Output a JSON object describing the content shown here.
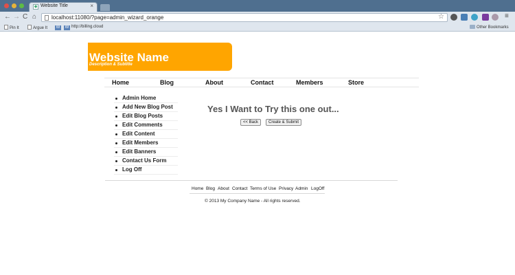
{
  "browser": {
    "tab_title": "Website Title",
    "tab_close": "×",
    "url": "localhost:11080/?page=admin_wizard_orange",
    "menu_glyph": "≡",
    "star_glyph": "☆",
    "nav": {
      "back": "←",
      "forward": "→",
      "reload": "C",
      "home": "⌂"
    },
    "bookmarks": [
      "Pin It",
      "Argue It",
      "http://billing.cloud",
      "Other Bookmarks"
    ]
  },
  "site": {
    "name": "Website Name",
    "description": "Description & Subtitle",
    "accent_color": "#ffa500"
  },
  "main_nav": [
    "Home",
    "Blog",
    "About",
    "Contact",
    "Members",
    "Store"
  ],
  "sidebar": [
    "Admin Home",
    "Add New Blog Post",
    "Edit Blog Posts",
    "Edit Comments",
    "Edit Content",
    "Edit Members",
    "Edit Banners",
    "Contact Us Form",
    "Log Off"
  ],
  "content": {
    "title": "Yes I Want to Try this one out...",
    "back_label": "<<  Back",
    "submit_label": "Create & Submit"
  },
  "footer": {
    "links": [
      "Home",
      "Blog",
      "About",
      "Contact",
      "Terms of Use",
      "Privacy",
      "Admin",
      "LogOff"
    ],
    "copyright": "© 2013 My Company Name - All rights reserved."
  }
}
